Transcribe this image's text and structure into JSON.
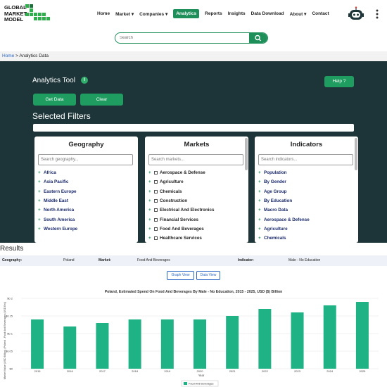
{
  "header": {
    "logo_lines": [
      "GLOBAL",
      "MARKET",
      "MODEL"
    ],
    "nav": [
      {
        "label": "Home",
        "active": false,
        "dropdown": false
      },
      {
        "label": "Market",
        "active": false,
        "dropdown": true
      },
      {
        "label": "Companies",
        "active": false,
        "dropdown": true
      },
      {
        "label": "Analytics",
        "active": true,
        "dropdown": false
      },
      {
        "label": "Reports",
        "active": false,
        "dropdown": false
      },
      {
        "label": "Insights",
        "active": false,
        "dropdown": false
      },
      {
        "label": "Data Download",
        "active": false,
        "dropdown": false
      },
      {
        "label": "About",
        "active": false,
        "dropdown": true
      },
      {
        "label": "Contact",
        "active": false,
        "dropdown": false
      }
    ],
    "icons": [
      "robot-icon",
      "more-menu-icon"
    ]
  },
  "search": {
    "placeholder": "Search",
    "icon": "search-icon"
  },
  "breadcrumb": {
    "home": "Home",
    "separator": ">",
    "current": "Analytics Data"
  },
  "tool": {
    "title": "Analytics Tool",
    "info_icon": "i",
    "help_label": "Help ?",
    "get_data_label": "Get Data",
    "clear_label": "Clear",
    "selected_filters_label": "Selected Filters"
  },
  "panels": {
    "geography": {
      "title": "Geography",
      "placeholder": "Search geography...",
      "items": [
        "Africa",
        "Asia Pacific",
        "Eastern Europe",
        "Middle East",
        "North America",
        "South America",
        "Western Europe"
      ]
    },
    "markets": {
      "title": "Markets",
      "placeholder": "Search markets...",
      "items": [
        "Aerospace & Defense",
        "Agriculture",
        "Chemicals",
        "Construction",
        "Electrical And Electronics",
        "Financial Services",
        "Food And Beverages",
        "Healthcare Services"
      ]
    },
    "indicators": {
      "title": "Indicators",
      "placeholder": "Search indicators...",
      "items": [
        "Population",
        "By Gender",
        "Age Group",
        "By Education",
        "Macro Data",
        "Aerospace & Defense",
        "Agriculture",
        "Chemicals"
      ]
    }
  },
  "results": {
    "title": "Results",
    "geography_label": "Geography:",
    "geography_value": "Poland",
    "market_label": "Market:",
    "market_value": "Food And Beverages",
    "indicator_label": "Indicator:",
    "indicator_value": "Male - No Education",
    "graph_view_label": "Graph View",
    "data_view_label": "Data View"
  },
  "colors": {
    "brand_green": "#1f8f5a",
    "dark_bg": "#1d3538",
    "bar": "#1fb285",
    "link_blue": "#2a67c6"
  },
  "chart_data": {
    "type": "bar",
    "title": "Poland, Estimated Spend On Food And Beverages By Male - No Education, 2015 - 2025, USD ($) Billion",
    "xlabel": "Year",
    "ylabel": "Market Value (USD Billion) (Poland - Food And Beverages (USD Bn))",
    "categories": [
      "2015",
      "2016",
      "2017",
      "2018",
      "2019",
      "2020",
      "2021",
      "2022",
      "2023",
      "2024",
      "2025"
    ],
    "series": [
      {
        "name": "Food And Beverages",
        "values": [
          0.14,
          0.12,
          0.13,
          0.14,
          0.14,
          0.14,
          0.15,
          0.17,
          0.16,
          0.18,
          0.19
        ]
      }
    ],
    "y_ticks": [
      "$0",
      "$0.05",
      "$0.1",
      "$0.15",
      "$0.2"
    ],
    "ylim": [
      0,
      0.2
    ],
    "grid": true,
    "legend": "bottom"
  }
}
